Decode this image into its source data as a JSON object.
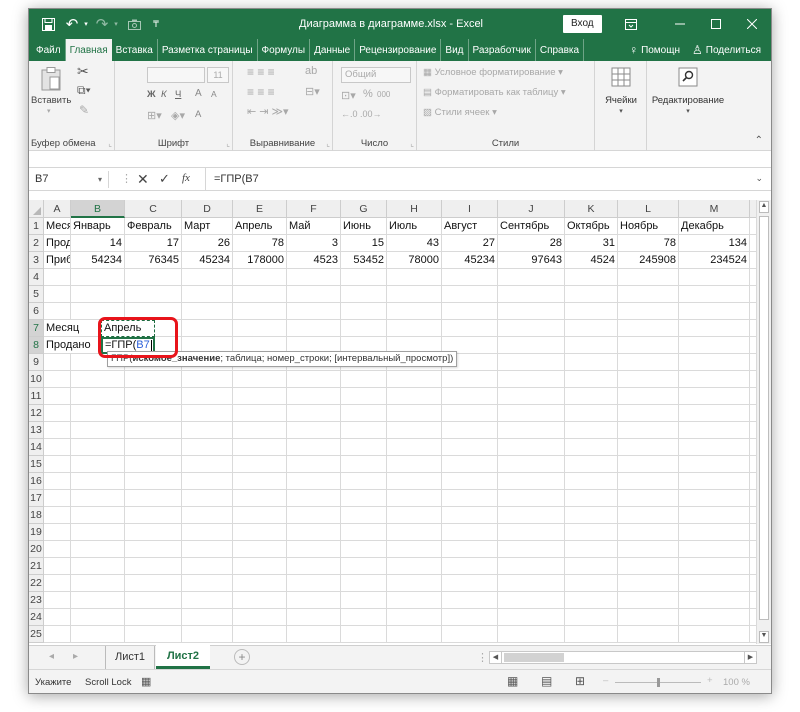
{
  "title": "Диаграмма в диаграмме.xlsx  -  Excel",
  "signin_label": "Вход",
  "tabs": [
    "Файл",
    "Главная",
    "Вставка",
    "Разметка страницы",
    "Формулы",
    "Данные",
    "Рецензирование",
    "Вид",
    "Разработчик",
    "Справка"
  ],
  "tabs_right": {
    "help_label": "Помощн",
    "share_label": "Поделиться"
  },
  "ribbon": {
    "clipboard": {
      "paste_label": "Вставить",
      "group_label": "Буфер обмена"
    },
    "font": {
      "size_value": "11",
      "bold": "Ж",
      "italic": "К",
      "underline": "Ч",
      "grow": "A",
      "shrink": "A",
      "color_letter": "A",
      "group_label": "Шрифт"
    },
    "alignment": {
      "group_label": "Выравнивание"
    },
    "number": {
      "format_value": "Общий",
      "percent": "%",
      "thousands": "000",
      "group_label": "Число"
    },
    "styles": {
      "conditional": "Условное форматирование",
      "as_table": "Форматировать как таблицу",
      "cell_styles": "Стили ячеек",
      "group_label": "Стили"
    },
    "cells": {
      "label": "Ячейки"
    },
    "editing": {
      "label": "Редактирование"
    }
  },
  "formula_bar": {
    "name_box": "B7",
    "fx": "fx",
    "formula": "=ГПР(B7"
  },
  "columns": [
    "A",
    "B",
    "C",
    "D",
    "E",
    "F",
    "G",
    "H",
    "I",
    "J",
    "K",
    "L",
    "M"
  ],
  "rows": [
    "1",
    "2",
    "3",
    "4",
    "5",
    "6",
    "7",
    "8",
    "9",
    "10",
    "11",
    "12",
    "13",
    "14",
    "15",
    "16",
    "17",
    "18",
    "19",
    "20",
    "21",
    "22",
    "23",
    "24",
    "25"
  ],
  "cells": {
    "row1": [
      "Месяц",
      "Январь",
      "Февраль",
      "Март",
      "Апрель",
      "Май",
      "Июнь",
      "Июль",
      "Август",
      "Сентябрь",
      "Октябрь",
      "Ноябрь",
      "Декабрь"
    ],
    "row2": [
      "Продано",
      "14",
      "17",
      "26",
      "78",
      "3",
      "15",
      "43",
      "27",
      "28",
      "31",
      "78",
      "134"
    ],
    "row3": [
      "Прибыль",
      "54234",
      "76345",
      "45234",
      "178000",
      "4523",
      "53452",
      "78000",
      "45234",
      "97643",
      "4524",
      "245908",
      "234524"
    ],
    "a7": "Месяц",
    "b7": "Апрель",
    "a8": "Продано",
    "b8_prefix": "=ГПР(",
    "b8_ref": "B7"
  },
  "tooltip": {
    "fn": "ГПР(",
    "arg1": "искомое_значение",
    "rest": "; таблица; номер_строки; [интервальный_просмотр])"
  },
  "sheets": [
    "Лист1",
    "Лист2"
  ],
  "status": {
    "mode": "Укажите",
    "scroll_lock": "Scroll Lock",
    "zoom": "100 %"
  },
  "colors": {
    "excel_green": "#217346",
    "highlight_red": "#e8141b",
    "ref_blue": "#2b5fd9"
  }
}
